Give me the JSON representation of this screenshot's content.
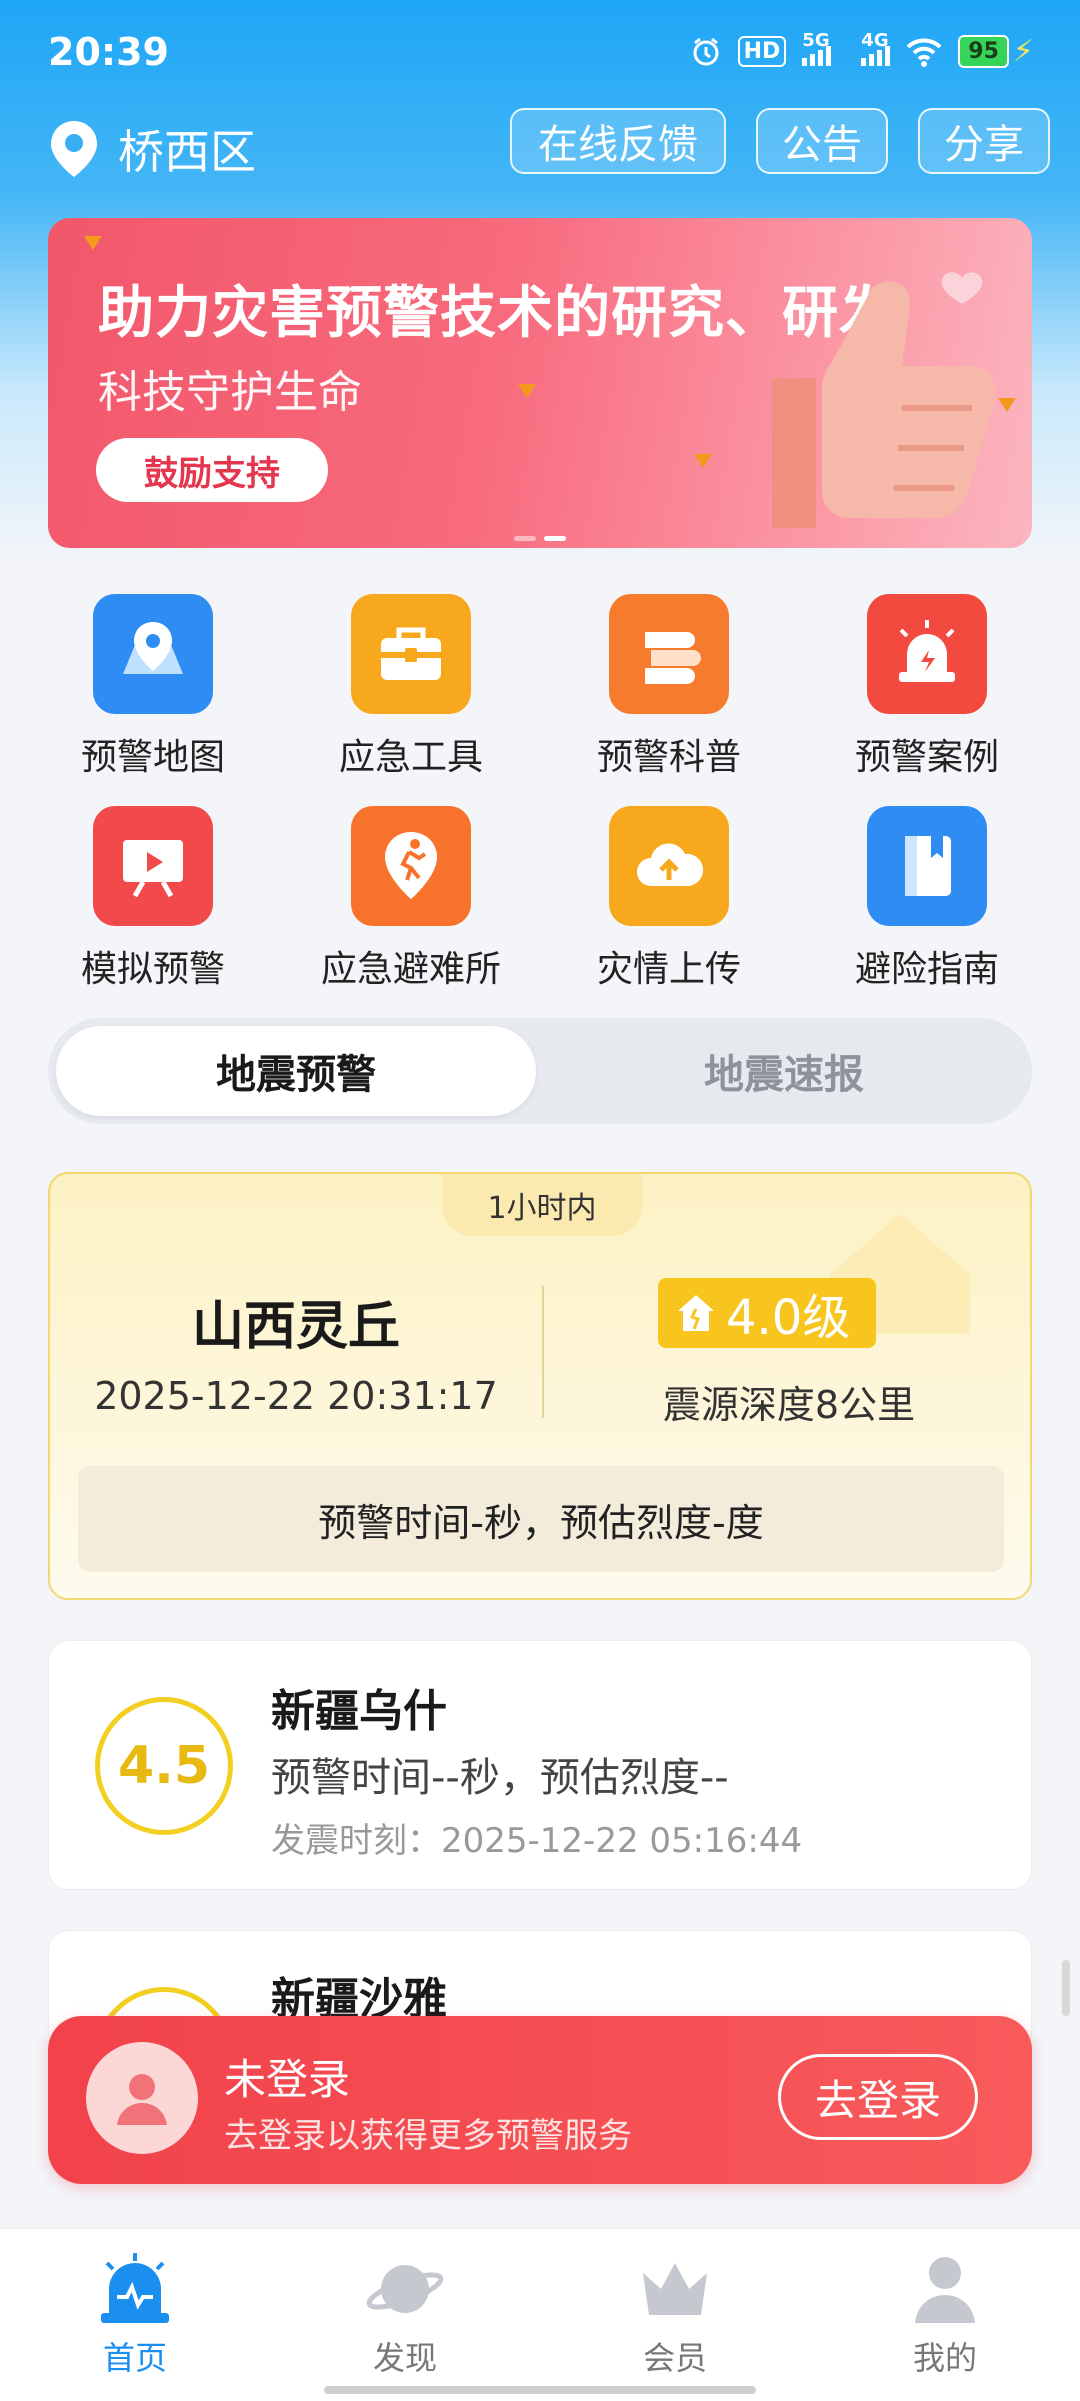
{
  "status_bar": {
    "time": "20:39",
    "hd": "HD",
    "net1": "5G",
    "net2": "4G",
    "battery": "95"
  },
  "header": {
    "location": "桥西区",
    "buttons": [
      "在线反馈",
      "公告",
      "分享"
    ]
  },
  "banner": {
    "title": "助力灾害预警技术的研究、研发",
    "subtitle": "科技守护生命",
    "button": "鼓励支持"
  },
  "grid": [
    {
      "label": "预警地图",
      "icon": "map-pin-icon",
      "color": "#2f8cf3"
    },
    {
      "label": "应急工具",
      "icon": "toolbox-icon",
      "color": "#f7a81c"
    },
    {
      "label": "预警科普",
      "icon": "book-stack-icon",
      "color": "#f77b2c"
    },
    {
      "label": "预警案例",
      "icon": "alarm-light-icon",
      "color": "#f24a3f"
    },
    {
      "label": "模拟预警",
      "icon": "presentation-play-icon",
      "color": "#f24a4a"
    },
    {
      "label": "应急避难所",
      "icon": "running-person-icon",
      "color": "#f7722a"
    },
    {
      "label": "灾情上传",
      "icon": "cloud-upload-icon",
      "color": "#f7a81c"
    },
    {
      "label": "避险指南",
      "icon": "guide-book-icon",
      "color": "#2f8cf3"
    }
  ],
  "tabs": {
    "active": "地震预警",
    "inactive": "地震速报"
  },
  "featured": {
    "tag": "1小时内",
    "location": "山西灵丘",
    "time": "2025-12-22 20:31:17",
    "magnitude": "4.0级",
    "depth": "震源深度8公里",
    "warning": "预警时间-秒，预估烈度-度"
  },
  "events": [
    {
      "magnitude": "4.5",
      "location": "新疆乌什",
      "warning": "预警时间--秒，预估烈度--",
      "time_label": "发震时刻：",
      "time": "2025-12-22 05:16:44"
    },
    {
      "location": "新疆沙雅"
    }
  ],
  "login": {
    "title": "未登录",
    "subtitle": "去登录以获得更多预警服务",
    "button": "去登录"
  },
  "nav": [
    "首页",
    "发现",
    "会员",
    "我的"
  ],
  "colors": {
    "accent": "#1a8ff0",
    "warning_yellow": "#f8c51e",
    "login_red": "#f2424c"
  }
}
